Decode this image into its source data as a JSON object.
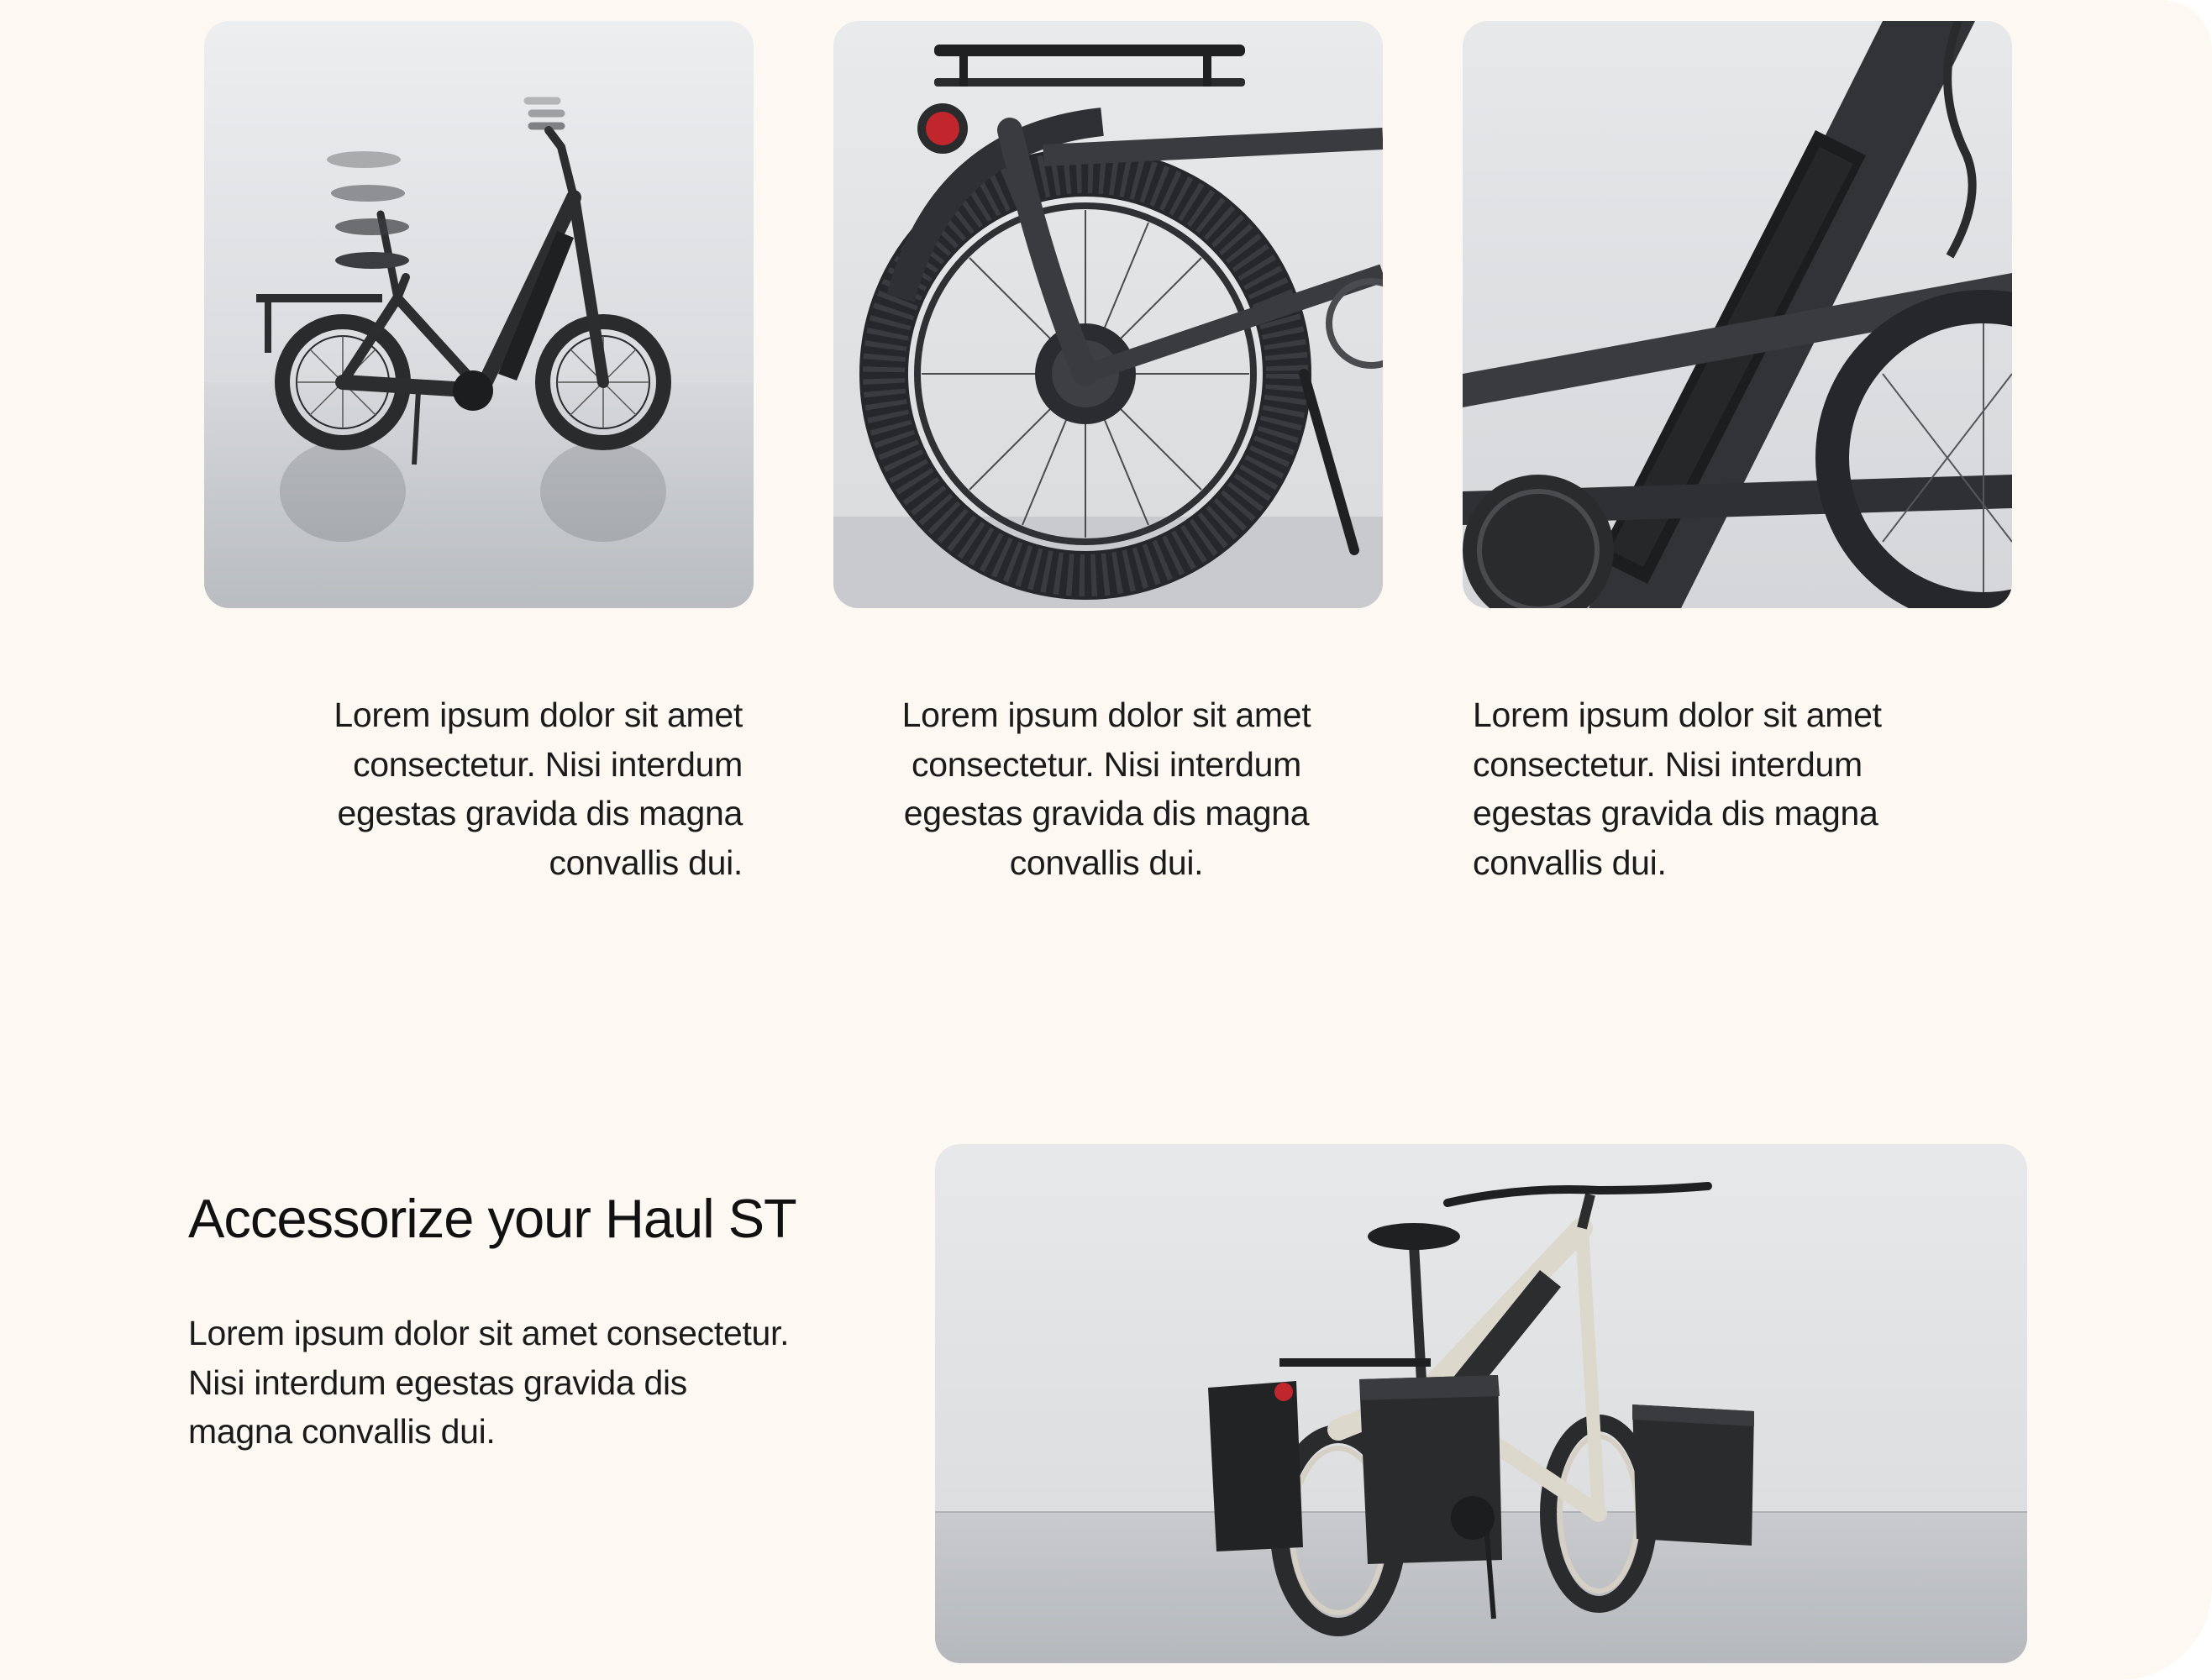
{
  "colors": {
    "page_background": "#fdf8f2",
    "text": "#1b1b1b",
    "bike_frame_dark": "#2c2d2f",
    "bike_frame_cream": "#ddd8cc",
    "tail_light": "#c0262c"
  },
  "feature_cards": [
    {
      "image": "folding-ebike-side-view-photo",
      "caption": "Lorem ipsum dolor sit amet consectetur. Nisi interdum egestas gravida dis magna convallis dui."
    },
    {
      "image": "ebike-rear-wheel-rack-closeup-photo",
      "caption": "Lorem ipsum dolor sit amet consectetur. Nisi interdum egestas gravida dis magna convallis dui."
    },
    {
      "image": "ebike-battery-frame-closeup-photo",
      "caption": "Lorem ipsum dolor sit amet consectetur. Nisi interdum egestas gravida dis magna convallis dui."
    }
  ],
  "accessorize": {
    "heading": "Accessorize your Haul ST",
    "body": "Lorem ipsum dolor sit amet consectetur. Nisi interdum egestas gravida dis magna convallis dui.",
    "image": "ebike-with-panniers-photo"
  }
}
